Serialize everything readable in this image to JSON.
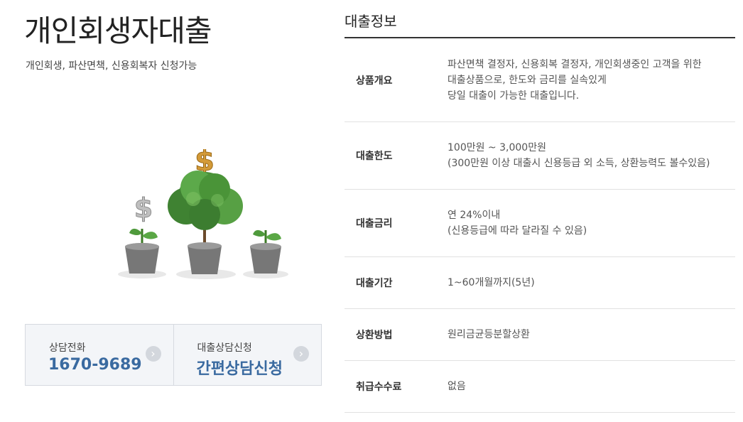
{
  "product": {
    "title": "개인회생자대출",
    "subtitle": "개인회생, 파산면책, 신용회복자 신청가능"
  },
  "cta": {
    "phone": {
      "label": "상담전화",
      "value": "1670-9689"
    },
    "apply": {
      "label": "대출상담신청",
      "value": "간편상담신청"
    }
  },
  "info": {
    "title": "대출정보",
    "rows": [
      {
        "label": "상품개요",
        "lines": [
          "파산면책 결정자, 신용회복 결정자, 개인회생중인 고객을 위한",
          "대출상품으로, 한도와 금리를 실속있게",
          "당일 대출이 가능한 대출입니다."
        ]
      },
      {
        "label": "대출한도",
        "lines": [
          "100만원 ~ 3,000만원",
          "(300만원 이상 대출시 신용등급 외 소득, 상환능력도 볼수있음)"
        ]
      },
      {
        "label": "대출금리",
        "lines": [
          "연 24%이내",
          "(신용등급에 따라 달라질 수 있음)"
        ]
      },
      {
        "label": "대출기간",
        "lines": [
          "1~60개월까지(5년)"
        ]
      },
      {
        "label": "상환방법",
        "lines": [
          "원리금균등분할상환"
        ]
      },
      {
        "label": "취급수수료",
        "lines": [
          "없음"
        ]
      }
    ]
  },
  "icons": {
    "cta_arrow": "chevron-right-icon",
    "illustration": "money-tree-icon"
  },
  "colors": {
    "accent": "#3a6aa0",
    "cta_bg": "#f3f5f8",
    "leaf": "#4f9a3c",
    "pot": "#7a7a7a",
    "coin": "#c8912e"
  }
}
